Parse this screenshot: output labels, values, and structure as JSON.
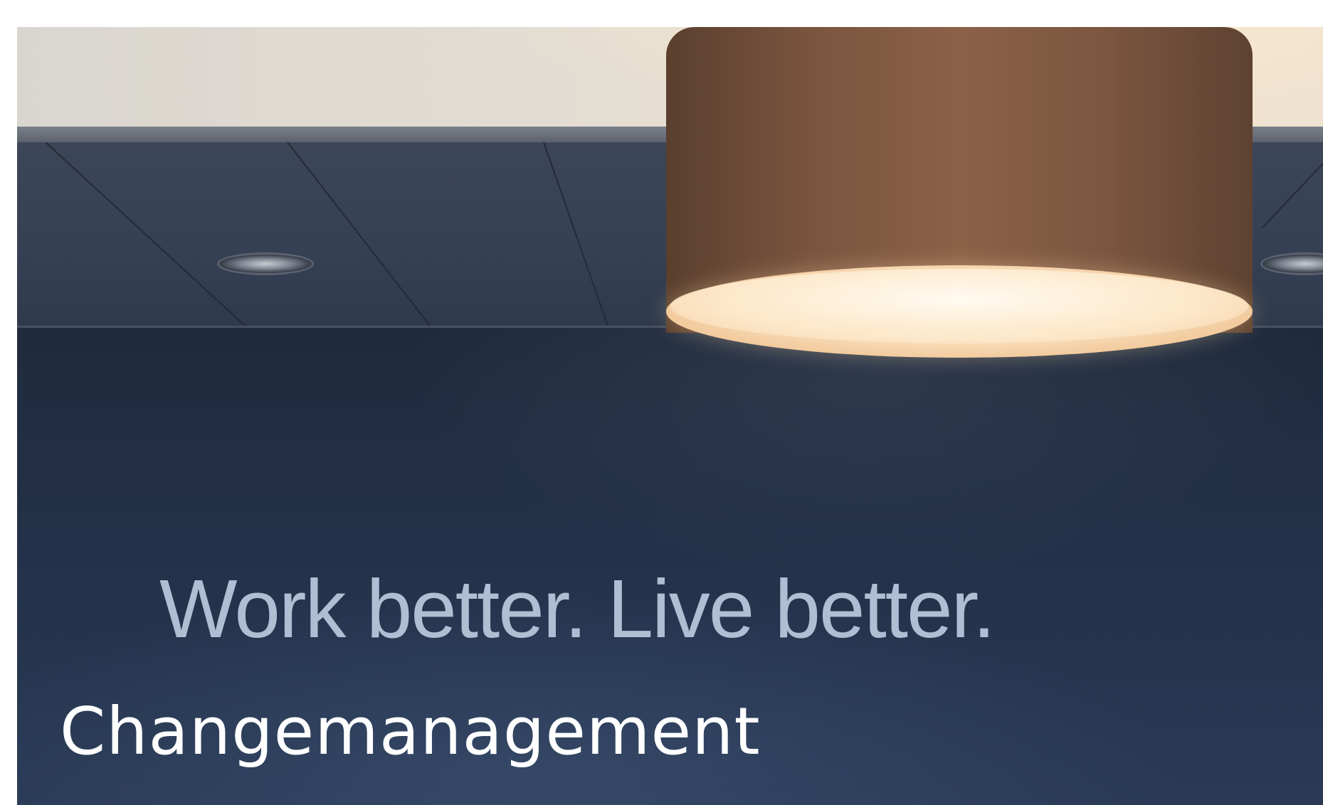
{
  "hero": {
    "tagline": "Work better. Live better.",
    "heading": "Changemanagement"
  },
  "colors": {
    "wall": "#27374f",
    "tagline": "#aebfd3",
    "heading": "#ffffff",
    "lamp_shade": "#7a5540",
    "lamp_glow": "#fbe3c2"
  }
}
